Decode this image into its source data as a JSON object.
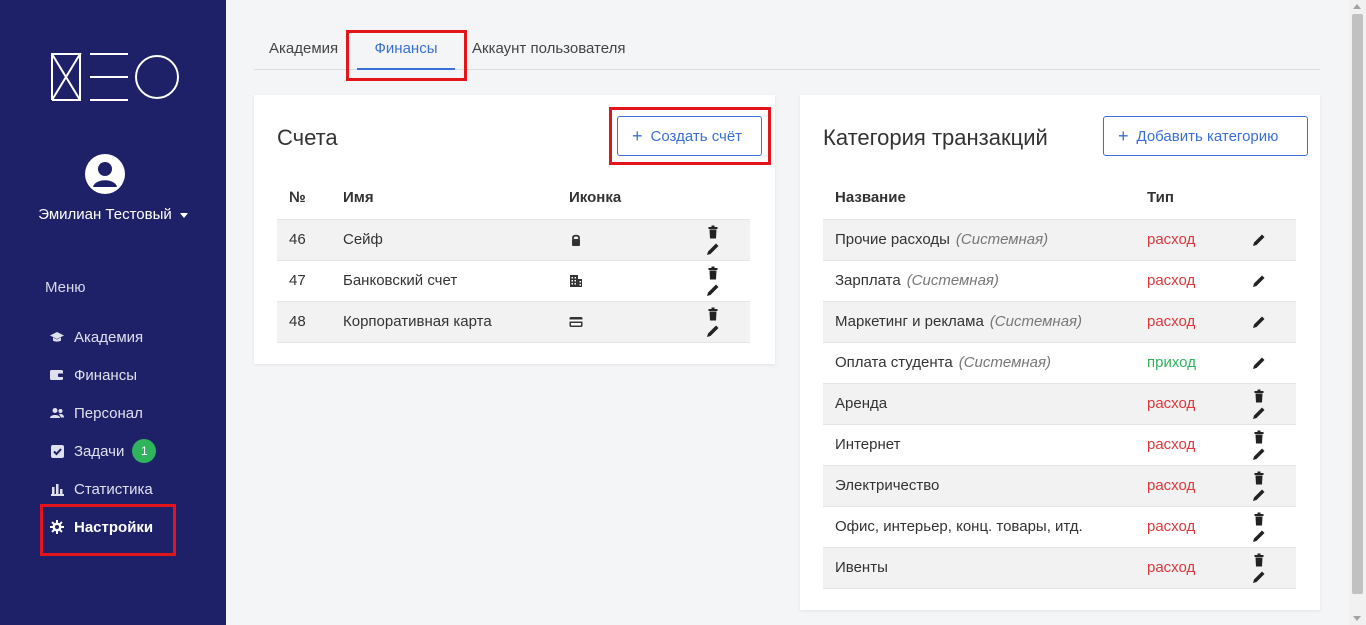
{
  "sidebar": {
    "logo_text": "NEO",
    "user_name": "Эмилиан Тестовый",
    "menu_title": "Меню",
    "items": [
      {
        "label": "Академия",
        "icon": "graduation-cap-icon"
      },
      {
        "label": "Финансы",
        "icon": "wallet-icon"
      },
      {
        "label": "Персонал",
        "icon": "users-icon"
      },
      {
        "label": "Задачи",
        "icon": "checkbox-icon",
        "badge": "1"
      },
      {
        "label": "Статистика",
        "icon": "bar-chart-icon"
      },
      {
        "label": "Настройки",
        "icon": "gear-icon",
        "active": true
      }
    ]
  },
  "tabs": [
    {
      "label": "Академия"
    },
    {
      "label": "Финансы",
      "active": true
    },
    {
      "label": "Аккаунт пользователя"
    }
  ],
  "accounts": {
    "title": "Счета",
    "create_button": "Создать счёт",
    "columns": [
      "№",
      "Имя",
      "Иконка"
    ],
    "rows": [
      {
        "id": "46",
        "name": "Сейф",
        "icon": "lock-icon"
      },
      {
        "id": "47",
        "name": "Банковский счет",
        "icon": "building-icon"
      },
      {
        "id": "48",
        "name": "Корпоративная карта",
        "icon": "credit-card-icon"
      }
    ]
  },
  "categories": {
    "title": "Категория транзакций",
    "add_button": "Добавить категорию",
    "columns": [
      "Название",
      "Тип"
    ],
    "system_label": "(Системная)",
    "rows": [
      {
        "name": "Прочие расходы",
        "system": true,
        "type": "расход"
      },
      {
        "name": "Зарплата",
        "system": true,
        "type": "расход"
      },
      {
        "name": "Маркетинг и реклама",
        "system": true,
        "type": "расход"
      },
      {
        "name": "Оплата студента",
        "system": true,
        "type": "приход"
      },
      {
        "name": "Аренда",
        "system": false,
        "type": "расход"
      },
      {
        "name": "Интернет",
        "system": false,
        "type": "расход"
      },
      {
        "name": "Электричество",
        "system": false,
        "type": "расход"
      },
      {
        "name": "Офис, интерьер, конц. товары, итд.",
        "system": false,
        "type": "расход"
      },
      {
        "name": "Ивенты",
        "system": false,
        "type": "расход"
      }
    ]
  },
  "colors": {
    "sidebar_bg": "#1f2168",
    "accent": "#3a6fd8",
    "expense": "#e0363c",
    "income": "#2fb35c",
    "highlight": "#e3151a"
  }
}
